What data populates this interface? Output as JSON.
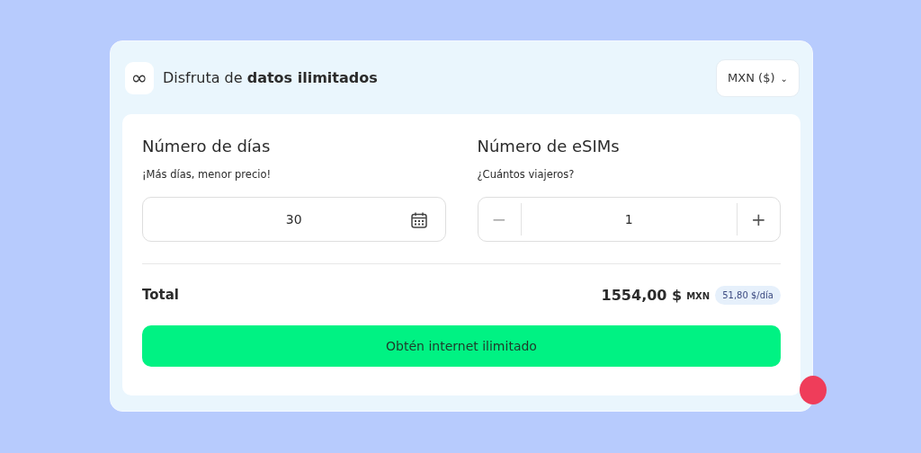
{
  "header": {
    "icon": "∞",
    "title": "Disfruta de **datos ilimitados**",
    "currency": "MXN ($)",
    "caret": "⌄"
  },
  "days": {
    "title": "Número de días",
    "subtitle": "¡Más días, menor precio!",
    "value": "30"
  },
  "esims": {
    "title": "Número de eSIMs",
    "subtitle": "¿Cuántos viajeros?",
    "minus": "−",
    "value": "1",
    "plus": "+"
  },
  "total": {
    "label": "Total",
    "amount": "1554,00 $",
    "currency": "MXN",
    "per_day": "51,80 $/día"
  },
  "cta": "Obtén internet ilimitado"
}
